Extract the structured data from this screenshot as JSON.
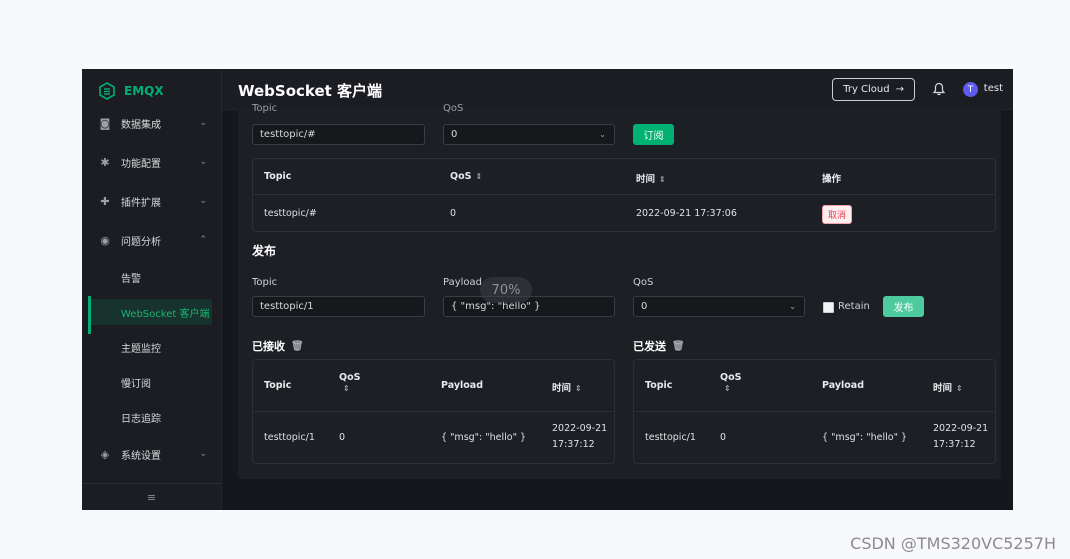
{
  "app": {
    "logo_text": "EMQX"
  },
  "header": {
    "title": "WebSocket 客户端",
    "try_cloud_label": "Try Cloud",
    "avatar_initial": "T",
    "username": "test"
  },
  "sidebar": {
    "items": [
      {
        "label": "数据集成",
        "icon": "integration-icon",
        "chevron": "⌄"
      },
      {
        "label": "功能配置",
        "icon": "gear-icon",
        "chevron": "⌄"
      },
      {
        "label": "插件扩展",
        "icon": "plugin-icon",
        "chevron": "⌄"
      },
      {
        "label": "问题分析",
        "icon": "diagnose-icon",
        "chevron": "⌃"
      },
      {
        "label": "系统设置",
        "icon": "system-icon",
        "chevron": "⌄"
      }
    ],
    "sub_items": [
      "告警",
      "WebSocket 客户端",
      "主题监控",
      "慢订阅",
      "日志追踪"
    ],
    "collapse_icon": "≡"
  },
  "subscribe": {
    "topic_label": "Topic",
    "qos_label": "QoS",
    "topic_value": "testtopic/#",
    "qos_value": "0",
    "button_label": "订阅",
    "table": {
      "headers": [
        "Topic",
        "QoS",
        "时间",
        "操作"
      ],
      "rows": [
        {
          "topic": "testtopic/#",
          "qos": "0",
          "time": "2022-09-21 17:37:06",
          "action": "取消"
        }
      ]
    }
  },
  "publish": {
    "title": "发布",
    "topic_label": "Topic",
    "payload_label": "Payload",
    "qos_label": "QoS",
    "topic_value": "testtopic/1",
    "payload_value": "{ \"msg\": \"hello\" }",
    "qos_value": "0",
    "retain_label": "Retain",
    "button_label": "发布"
  },
  "loading_text": "70%",
  "received": {
    "title": "已接收",
    "headers": [
      "Topic",
      "QoS",
      "Payload",
      "时间"
    ],
    "rows": [
      {
        "topic": "testtopic/1",
        "qos": "0",
        "payload": "{ \"msg\": \"hello\" }",
        "time_date": "2022-09-21",
        "time_clock": "17:37:12"
      }
    ]
  },
  "sent": {
    "title": "已发送",
    "headers": [
      "Topic",
      "QoS",
      "Payload",
      "时间"
    ],
    "rows": [
      {
        "topic": "testtopic/1",
        "qos": "0",
        "payload": "{ \"msg\": \"hello\" }",
        "time_date": "2022-09-21",
        "time_clock": "17:37:12"
      }
    ]
  },
  "watermark": "CSDN @TMS320VC5257H",
  "colors": {
    "accent": "#00b173",
    "background": "#15171c",
    "danger": "#e0424e"
  }
}
